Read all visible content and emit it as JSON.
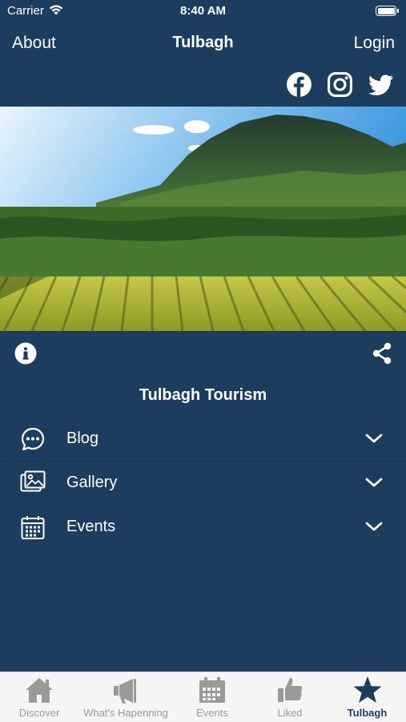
{
  "status_bar": {
    "carrier": "Carrier",
    "time": "8:40 AM"
  },
  "nav": {
    "left": "About",
    "title": "Tulbagh",
    "right": "Login"
  },
  "social": [
    "facebook-icon",
    "instagram-icon",
    "twitter-icon"
  ],
  "hero": {
    "description": "mountain and vineyard landscape photo"
  },
  "section_title": "Tulbagh Tourism",
  "menu": [
    {
      "label": "Blog",
      "icon": "chat-bubble-icon"
    },
    {
      "label": "Gallery",
      "icon": "gallery-icon"
    },
    {
      "label": "Events",
      "icon": "calendar-icon"
    }
  ],
  "tabs": [
    {
      "label": "Discover",
      "icon": "home-icon"
    },
    {
      "label": "What's Hapenning",
      "icon": "megaphone-icon"
    },
    {
      "label": "Events",
      "icon": "calendar-icon"
    },
    {
      "label": "Liked",
      "icon": "thumbs-up-icon"
    },
    {
      "label": "Tulbagh",
      "icon": "star-icon",
      "active": true
    }
  ],
  "colors": {
    "background": "#1d3d5e",
    "tab_bar": "#f5f5f5",
    "tab_inactive": "#9a9a9a",
    "tab_active": "#1d3d5e"
  }
}
